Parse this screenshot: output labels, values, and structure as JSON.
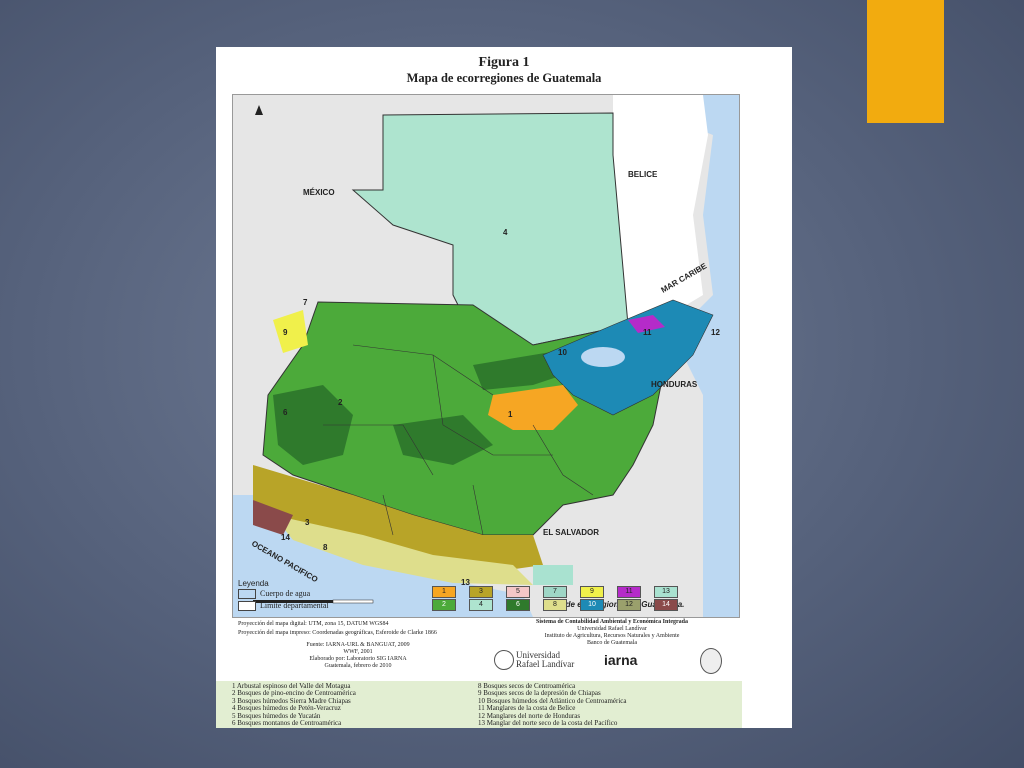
{
  "figure": {
    "label": "Figura 1",
    "title": "Mapa de ecorregiones de Guatemala"
  },
  "map": {
    "countries": [
      "MÉXICO",
      "BELICE",
      "HONDURAS",
      "EL SALVADOR"
    ],
    "seas": [
      "MAR CARIBE",
      "OCEANO PACIFICO"
    ],
    "caption": "Mapa de ecorregiones de Guatemala.",
    "region_numbers": [
      "4",
      "1",
      "2",
      "3",
      "6",
      "7",
      "8",
      "9",
      "10",
      "11",
      "12",
      "13",
      "14"
    ]
  },
  "legend": {
    "title": "Leyenda",
    "water": "Cuerpo de agua",
    "boundary": "Límite departamental",
    "chips_top": [
      {
        "num": "1",
        "color": "#f6a623"
      },
      {
        "num": "3",
        "color": "#b8a428"
      },
      {
        "num": "5",
        "color": "#f4c7c7"
      },
      {
        "num": "7",
        "color": "#9fd6c6"
      },
      {
        "num": "9",
        "color": "#f0f04b"
      },
      {
        "num": "11",
        "color": "#b52bc9"
      },
      {
        "num": "13",
        "color": "#a9e2d0"
      }
    ],
    "chips_bottom": [
      {
        "num": "2",
        "color": "#4caa3a"
      },
      {
        "num": "4",
        "color": "#aee4cf"
      },
      {
        "num": "6",
        "color": "#2f7a2c"
      },
      {
        "num": "8",
        "color": "#dede8c"
      },
      {
        "num": "10",
        "color": "#1d8ab5"
      },
      {
        "num": "12",
        "color": "#9aa06c"
      },
      {
        "num": "14",
        "color": "#8a4a4a"
      }
    ]
  },
  "info": {
    "projection_digital": "Proyección del mapa digital: UTM, zona 15, DATUM WGS84",
    "projection_print": "Proyección del mapa impreso: Coordenadas geográficas, Esferoide de Clarke 1866",
    "source_line1": "Fuente: IARNA-URL & BANGUAT, 2009",
    "source_line2": "WWF, 2001",
    "source_line3": "Elaborado por: Laboratorio SIG IARNA",
    "source_line4": "Guatemala, febrero de 2010",
    "system_title": "Sistema de Contabilidad Ambiental y Económica Integrada",
    "system_line2": "Universidad Rafael Landívar",
    "system_line3": "Instituto de Agricultura, Recursos Naturales y Ambiente",
    "system_line4": "Banco de Guatemala",
    "logo_url_1": "Universidad",
    "logo_url_2": "Rafael Landívar",
    "logo_iarna": "iarna"
  },
  "ecoregions_left": [
    "1 Arbustal espinoso del Valle del Motagua",
    "2 Bosques de pino-encino de Centroamérica",
    "3 Bosques húmedos Sierra Madre Chiapas",
    "4 Bosques húmedos de Petén-Veracruz",
    "5 Bosques húmedos de Yucatán",
    "6 Bosques montanos de Centroamérica"
  ],
  "ecoregions_right": [
    "8 Bosques secos de Centroamérica",
    "9 Bosques secos de la depresión de Chiapas",
    "10 Bosques húmedos del Atlántico de Centroamérica",
    "11 Manglares de la costa de Belice",
    "12 Manglares del norte de Honduras",
    "13 Manglar del norte seco de la costa del Pacífico"
  ],
  "colors": {
    "accent": "#f2ab0f",
    "background": "#56627c"
  }
}
